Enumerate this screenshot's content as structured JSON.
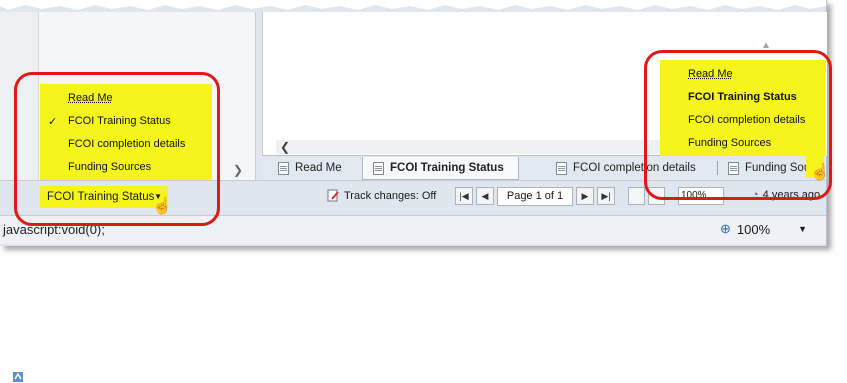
{
  "left_tab_menu": {
    "items": [
      {
        "label": "Read Me",
        "checked": false
      },
      {
        "label": "FCOI Training Status",
        "checked": true
      },
      {
        "label": "FCOI completion details",
        "checked": false
      },
      {
        "label": "Funding Sources",
        "checked": false
      }
    ],
    "check_glyph": "✓"
  },
  "right_tab_menu": {
    "items": [
      {
        "label": "Read Me",
        "bold": false
      },
      {
        "label": "FCOI Training Status",
        "bold": true
      },
      {
        "label": "FCOI completion details",
        "bold": false
      },
      {
        "label": "Funding Sources",
        "bold": false
      }
    ]
  },
  "sheet_selector": {
    "label": "FCOI Training Status",
    "caret": "▼"
  },
  "tabs": [
    {
      "label": "Read Me",
      "active": false
    },
    {
      "label": "FCOI Training Status",
      "active": true
    },
    {
      "label": "FCOI completion details",
      "active": false
    },
    {
      "label": "Funding Sour",
      "active": false
    }
  ],
  "status": {
    "track_changes": "Track changes: Off",
    "page": "Page 1 of 1",
    "zoom": "100%",
    "timestamp": "4 years ago"
  },
  "nav_buttons": {
    "first": "|◀",
    "prev": "◀",
    "next": "▶",
    "last": "▶|"
  },
  "browser_status": {
    "text": "javascript:void(0);",
    "zoom": "100%",
    "dropdown": "▼"
  },
  "colors": {
    "highlight": "#f5f51d",
    "ring": "#e01818",
    "accent": "#2b6cb0"
  },
  "icons": [
    "doc-icon",
    "check-icon",
    "hand-cursor-icon",
    "track-changes-icon",
    "zoom-icon",
    "page-view-icon"
  ]
}
